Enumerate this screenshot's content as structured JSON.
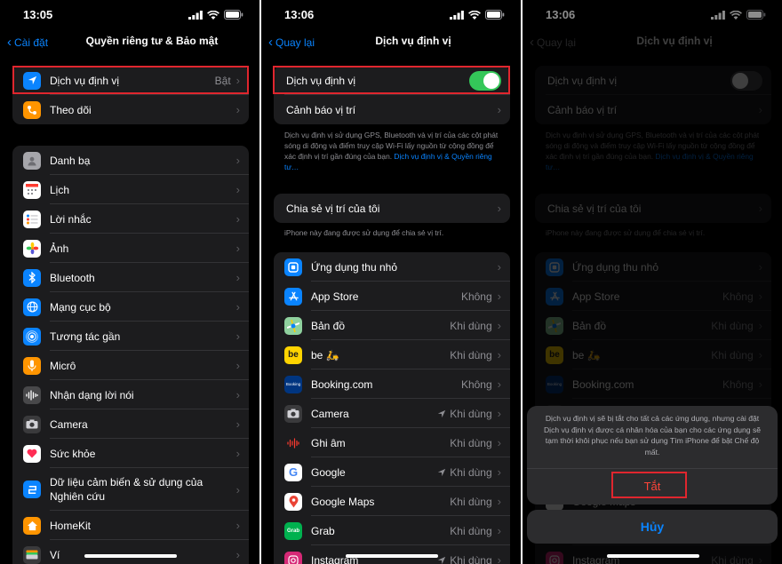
{
  "colors": {
    "accent": "#0a84ff",
    "green": "#34c759",
    "destructive": "#ff453a",
    "highlight": "#e0262e"
  },
  "screen1": {
    "time": "13:05",
    "back": "Cài đặt",
    "title": "Quyền riêng tư & Bảo mật",
    "top": [
      {
        "label": "Dịch vụ định vị",
        "value": "Bật",
        "icon": "location-arrow-icon",
        "color": "#0a84ff"
      },
      {
        "label": "Theo dõi",
        "value": "",
        "icon": "tracking-icon",
        "color": "#ff9500"
      }
    ],
    "apps": [
      {
        "label": "Danh bạ",
        "icon": "contacts-icon",
        "color": "#8e8e93"
      },
      {
        "label": "Lịch",
        "icon": "calendar-icon",
        "color": "#ffffff"
      },
      {
        "label": "Lời nhắc",
        "icon": "reminders-icon",
        "color": "#ffffff"
      },
      {
        "label": "Ảnh",
        "icon": "photos-icon",
        "color": "#ffffff"
      },
      {
        "label": "Bluetooth",
        "icon": "bluetooth-icon",
        "color": "#0a84ff"
      },
      {
        "label": "Mạng cục bộ",
        "icon": "local-network-icon",
        "color": "#0a84ff"
      },
      {
        "label": "Tương tác gần",
        "icon": "nearby-interactions-icon",
        "color": "#0a84ff"
      },
      {
        "label": "Micrô",
        "icon": "microphone-icon",
        "color": "#ff9500"
      },
      {
        "label": "Nhận dạng lời nói",
        "icon": "speech-waveform-icon",
        "color": "#8e8e93"
      },
      {
        "label": "Camera",
        "icon": "camera-icon",
        "color": "#8e8e93"
      },
      {
        "label": "Sức khỏe",
        "icon": "health-heart-icon",
        "color": "#ffffff"
      },
      {
        "label": "Dữ liệu cảm biến & sử dụng của Nghiên cứu",
        "icon": "research-icon",
        "color": "#0a84ff"
      },
      {
        "label": "HomeKit",
        "icon": "home-icon",
        "color": "#ff9500"
      },
      {
        "label": "Ví",
        "icon": "wallet-icon",
        "color": "#8e8e93"
      }
    ]
  },
  "screen2": {
    "time": "13:06",
    "back": "Quay lại",
    "title": "Dịch vụ định vị",
    "toggle_label": "Dịch vụ định vị",
    "toggle_on": true,
    "alerts_label": "Cảnh báo vị trí",
    "note": "Dịch vụ định vị sử dụng GPS, Bluetooth và vị trí của các cột phát sóng di động và điểm truy cập Wi-Fi lấy nguồn từ cộng đồng để xác định vị trí gần đúng của bạn.",
    "note_link": "Dịch vụ định vị & Quyền riêng tư…",
    "share_label": "Chia sẻ vị trí của tôi",
    "share_note": "iPhone này đang được sử dụng để chia sẻ vị trí.",
    "apps": [
      {
        "label": "Ứng dụng thu nhỏ",
        "value": "",
        "icon": "app-clips-icon",
        "color": "#0a84ff",
        "arrow": false
      },
      {
        "label": "App Store",
        "value": "Không",
        "icon": "app-store-icon",
        "color": "#0a84ff",
        "arrow": false
      },
      {
        "label": "Bản đồ",
        "value": "Khi dùng",
        "icon": "maps-icon",
        "color": "#34c759",
        "arrow": false
      },
      {
        "label": "be 🛵",
        "value": "Khi dùng",
        "icon": "be-app-icon",
        "color": "#ffd400",
        "arrow": false
      },
      {
        "label": "Booking.com",
        "value": "Không",
        "icon": "booking-icon",
        "color": "#003580",
        "arrow": false
      },
      {
        "label": "Camera",
        "value": "Khi dùng",
        "icon": "camera-icon",
        "color": "#8e8e93",
        "arrow": true
      },
      {
        "label": "Ghi âm",
        "value": "Khi dùng",
        "icon": "voice-memos-icon",
        "color": "#1c1c1e",
        "arrow": false
      },
      {
        "label": "Google",
        "value": "Khi dùng",
        "icon": "google-icon",
        "color": "#ffffff",
        "arrow": true
      },
      {
        "label": "Google Maps",
        "value": "Khi dùng",
        "icon": "google-maps-icon",
        "color": "#ffffff",
        "arrow": false
      },
      {
        "label": "Grab",
        "value": "Khi dùng",
        "icon": "grab-icon",
        "color": "#00b14f",
        "arrow": false
      },
      {
        "label": "Instagram",
        "value": "Khi dùng",
        "icon": "instagram-icon",
        "color": "#d62976",
        "arrow": true
      }
    ]
  },
  "screen3": {
    "time": "13:06",
    "back": "Quay lại",
    "title": "Dịch vụ định vị",
    "toggle_on": false,
    "sheet_message": "Dịch vụ định vị sẽ bị tắt cho tất cả các ứng dụng, nhưng cài đặt Dịch vụ định vị được cá nhân hóa của bạn cho các ứng dụng sẽ tạm thời khôi phục nếu bạn sử dụng Tìm iPhone để bật Chế độ mất.",
    "turn_off": "Tắt",
    "cancel": "Hủy",
    "behind_label": "Google Maps"
  }
}
